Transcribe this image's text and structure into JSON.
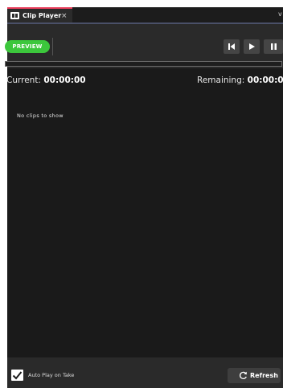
{
  "tab": {
    "title": "Clip Player",
    "close_glyph": "×",
    "icon": "film-icon"
  },
  "tabbar": {
    "overflow_glyph": "v"
  },
  "toolbar": {
    "preview_label": "PREVIEW",
    "preview_color": "#3cc73c",
    "buttons": [
      "skip-to-start-icon",
      "play-icon",
      "pause-icon"
    ]
  },
  "progress": {
    "value": 0
  },
  "timeline": {
    "current_label": "Current:",
    "current_value": "00:00:00",
    "remaining_label": "Remaining:",
    "remaining_value": "00:00:00"
  },
  "clips": {
    "empty_message": "No clips to show",
    "items": []
  },
  "footer": {
    "autoplay_label": "Auto Play on Take",
    "autoplay_checked": true,
    "refresh_label": "Refresh",
    "refresh_icon": "refresh-icon"
  },
  "colors": {
    "accent_tab": "#e83c5a",
    "panel_bg": "#1a1a1a",
    "toolbar_bg": "#2a2a2a"
  }
}
